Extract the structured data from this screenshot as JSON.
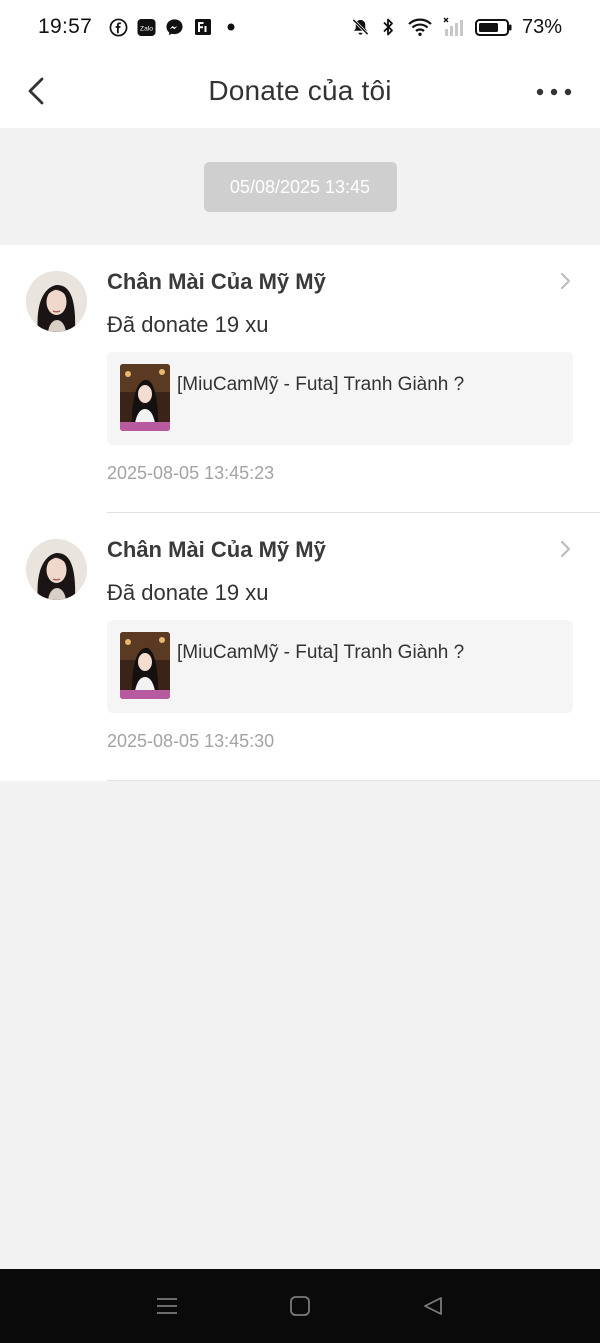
{
  "status_bar": {
    "time": "19:57",
    "notification_icons": [
      "facebook-icon",
      "zalo-icon",
      "messenger-icon",
      "facebook-pages-icon",
      "dot-icon"
    ],
    "zalo_label": "Zalo",
    "battery_percent": "73%",
    "battery_level": 0.73
  },
  "header": {
    "title": "Donate của tôi",
    "back_icon": "chevron-left-icon",
    "more_icon": "more-horizontal-icon"
  },
  "date_separator": "05/08/2025 13:45",
  "donations": [
    {
      "name": "Chân Mài Của Mỹ Mỹ",
      "amount": "Đã donate 19 xu",
      "video_title": "[MiuCamMỹ - Futa] Tranh Giành ?",
      "time": "2025-08-05 13:45:23"
    },
    {
      "name": "Chân Mài Của Mỹ Mỹ",
      "amount": "Đã donate 19 xu",
      "video_title": "[MiuCamMỹ - Futa] Tranh Giành ?",
      "time": "2025-08-05 13:45:30"
    }
  ],
  "system_nav": {
    "items": [
      "menu-icon",
      "home-icon",
      "back-triangle-icon"
    ]
  },
  "colors": {
    "page_bg": "#f2f2f2",
    "card_bg": "#ffffff",
    "date_pill_bg": "#cfcfcf",
    "muted_text": "#a3a3a3",
    "nav_bar_bg": "#0a0a0a"
  }
}
